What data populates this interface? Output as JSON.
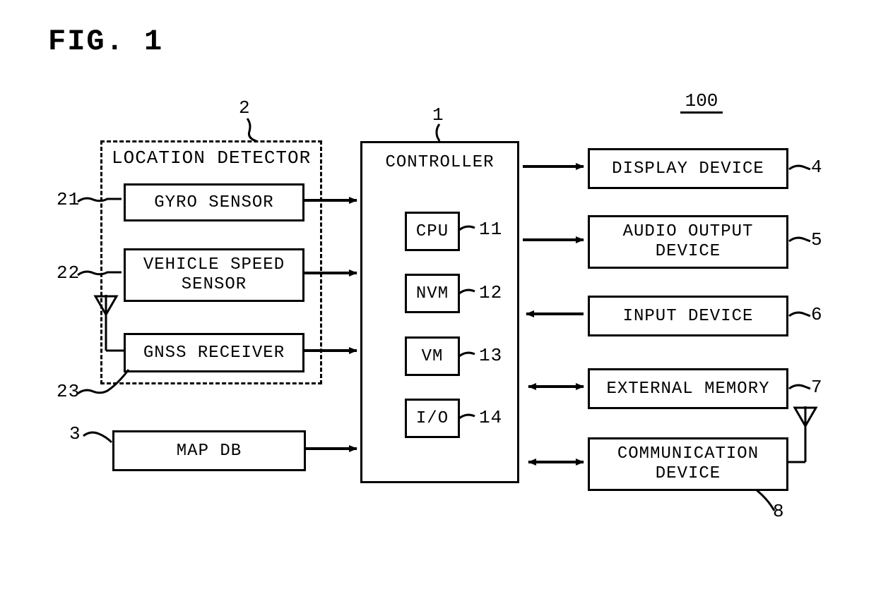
{
  "figure_title": "FIG. 1",
  "system_ref": "100",
  "controller": {
    "title": "CONTROLLER",
    "ref": "1",
    "parts": {
      "cpu": {
        "label": "CPU",
        "ref": "11"
      },
      "nvm": {
        "label": "NVM",
        "ref": "12"
      },
      "vm": {
        "label": "VM",
        "ref": "13"
      },
      "io": {
        "label": "I/O",
        "ref": "14"
      }
    }
  },
  "location_detector": {
    "title": "LOCATION DETECTOR",
    "ref": "2",
    "parts": {
      "gyro": {
        "label": "GYRO SENSOR",
        "ref": "21"
      },
      "speed": {
        "label": "VEHICLE SPEED\nSENSOR",
        "ref": "22"
      },
      "gnss": {
        "label": "GNSS RECEIVER",
        "ref": "23"
      }
    }
  },
  "map_db": {
    "label": "MAP DB",
    "ref": "3"
  },
  "right": {
    "display": {
      "label": "DISPLAY DEVICE",
      "ref": "4"
    },
    "audio": {
      "label": "AUDIO OUTPUT\nDEVICE",
      "ref": "5"
    },
    "input": {
      "label": "INPUT DEVICE",
      "ref": "6"
    },
    "extmem": {
      "label": "EXTERNAL MEMORY",
      "ref": "7"
    },
    "comm": {
      "label": "COMMUNICATION\nDEVICE",
      "ref": "8"
    }
  }
}
